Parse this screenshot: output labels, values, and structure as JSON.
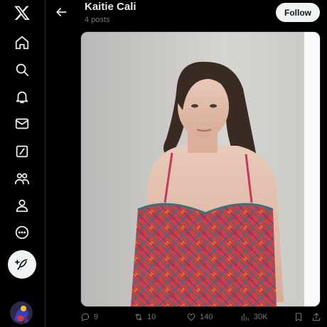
{
  "profile": {
    "name": "Kaitie Cali",
    "post_count": "4 posts"
  },
  "header": {
    "follow_label": "Follow"
  },
  "nav": {
    "icons": [
      "x-logo-icon",
      "home-icon",
      "search-icon",
      "notifications-bell-icon",
      "messages-envelope-icon",
      "grok-slash-icon",
      "communities-icon",
      "profile-icon",
      "more-circle-icon"
    ],
    "compose_icon": "feather-plus-icon"
  },
  "post_actions": {
    "replies": "9",
    "reposts": "10",
    "likes": "140",
    "views": "30K"
  },
  "colors": {
    "background": "#000000",
    "text_primary": "#e7e9ea",
    "text_secondary": "#71767b",
    "follow_button": "#eff3f4",
    "border": "#2f3336"
  }
}
